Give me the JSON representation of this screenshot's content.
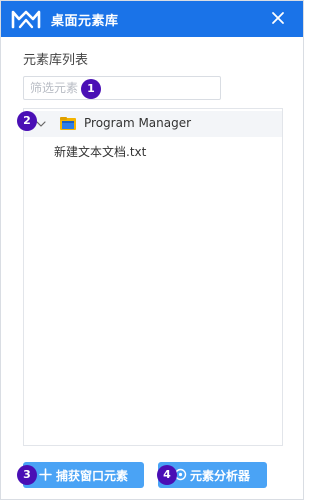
{
  "window": {
    "title": "桌面元素库",
    "close_icon": "close-icon",
    "logo_icon": "app-logo-icon",
    "accent_color": "#1a73e8"
  },
  "library": {
    "section_label": "元素库列表",
    "filter": {
      "placeholder": "筛选元素",
      "value": ""
    }
  },
  "tree": {
    "nodes": [
      {
        "label": "Program Manager",
        "icon": "folder-window-icon",
        "expanded": true,
        "children": [
          {
            "label": "新建文本文档.txt"
          }
        ]
      }
    ]
  },
  "buttons": {
    "capture": {
      "label": "捕获窗口元素",
      "icon": "plus-icon"
    },
    "analyzer": {
      "label": "元素分析器",
      "icon": "target-icon"
    },
    "color": "#4aa3f5"
  },
  "badges": {
    "filter": "1",
    "tree": "2",
    "capture": "3",
    "analyzer": "4",
    "color": "#4a0fb5"
  }
}
